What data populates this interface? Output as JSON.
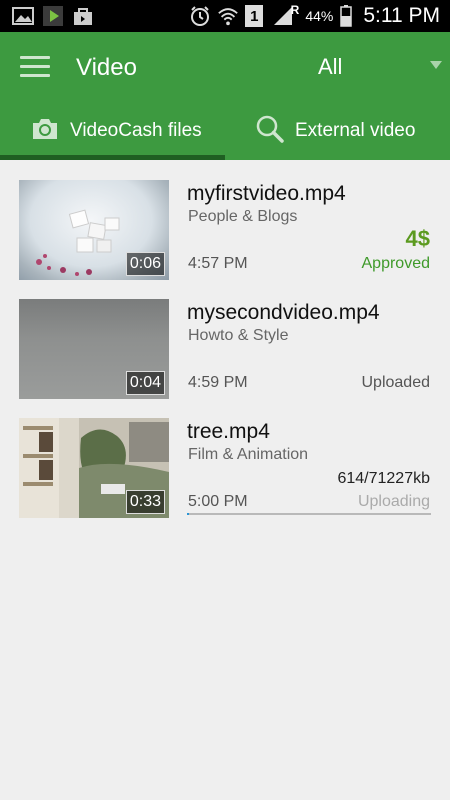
{
  "status_bar": {
    "battery": "44%",
    "time": "5:11 PM",
    "network": "R",
    "sim_slot": "1",
    "icons": [
      "gallery-icon",
      "play-store-icon",
      "bag-icon",
      "alarm-icon",
      "wifi-icon",
      "sim-icon",
      "signal-icon",
      "battery-icon"
    ]
  },
  "action_bar": {
    "title": "Video",
    "filter": "All"
  },
  "tabs": [
    {
      "label": "VideoCash files",
      "icon": "camera-icon",
      "selected": true
    },
    {
      "label": "External video",
      "icon": "search-icon",
      "selected": false
    }
  ],
  "videos": [
    {
      "title": "myfirstvideo.mp4",
      "category": "People & Blogs",
      "duration": "0:06",
      "time": "4:57 PM",
      "price": "4$",
      "status": "Approved",
      "status_color": "#3f9a2a"
    },
    {
      "title": "mysecondvideo.mp4",
      "category": "Howto & Style",
      "duration": "0:04",
      "time": "4:59 PM",
      "status": "Uploaded",
      "status_color": "#555555"
    },
    {
      "title": "tree.mp4",
      "category": "Film & Animation",
      "duration": "0:33",
      "time": "5:00 PM",
      "size": "614/71227kb",
      "status": "Uploading",
      "status_color": "#aaaaaa",
      "progress": 0.009
    }
  ],
  "colors": {
    "accent": "#3d9a40",
    "tab_indicator": "#1f5f22",
    "background": "#efefef",
    "progress": "#2a95d5"
  }
}
